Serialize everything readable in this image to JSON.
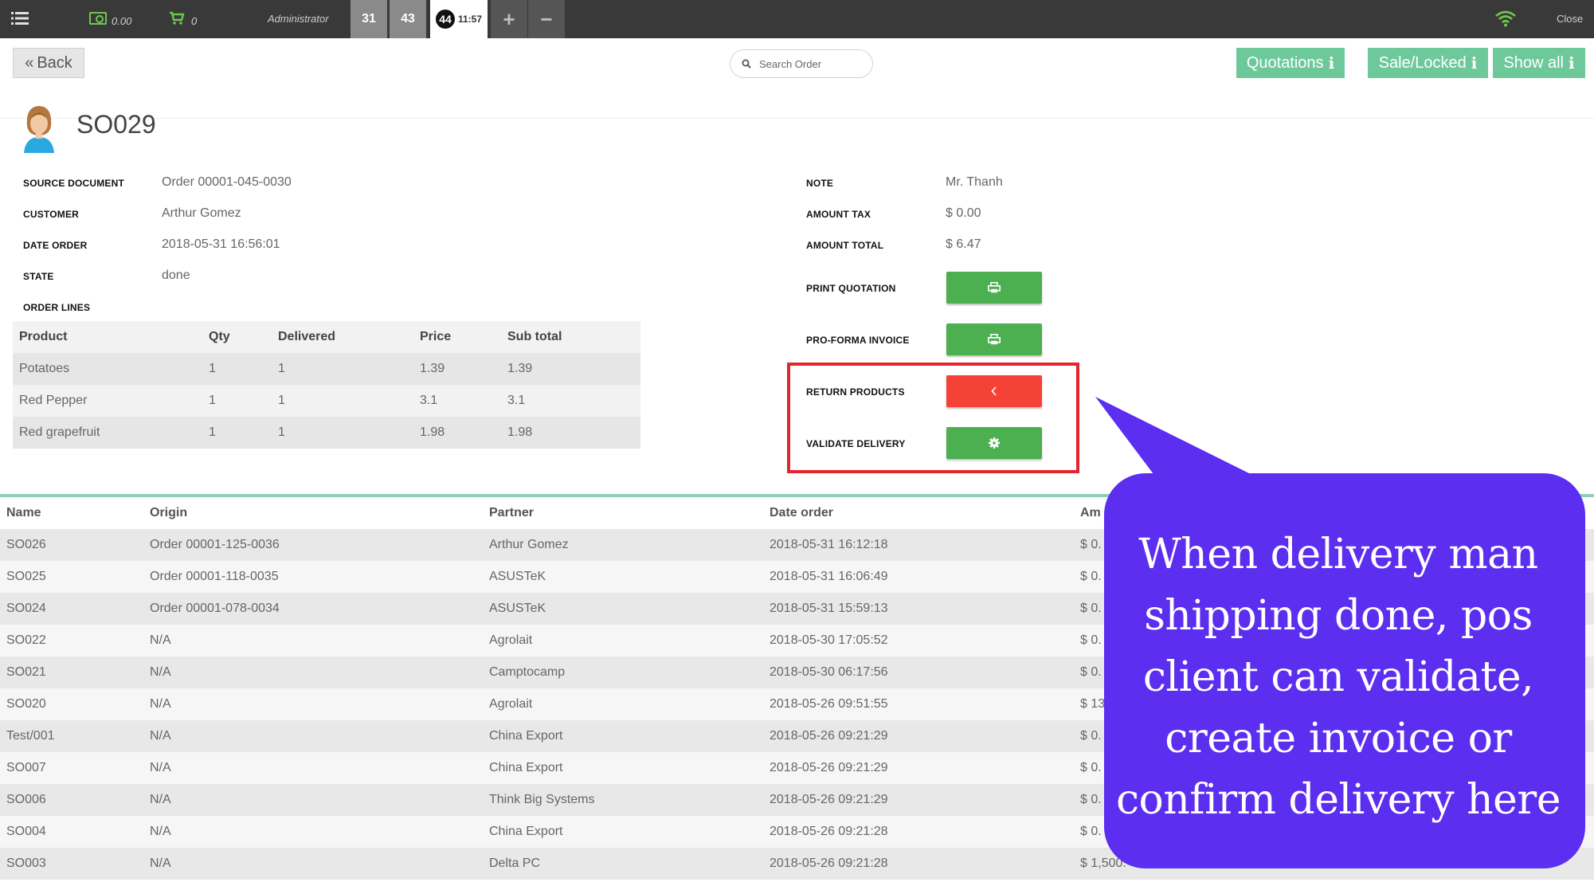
{
  "topbar": {
    "cash_amount": "0.00",
    "cart_count": "0",
    "user": "Administrator",
    "order_tabs": [
      "31",
      "43"
    ],
    "active_tab": {
      "number": "44",
      "time": "11:57"
    },
    "plus": "+",
    "minus": "−",
    "close_label": "Close"
  },
  "actions": {
    "back_label": "Back",
    "search_placeholder": "Search Order",
    "quotations_label": "Quotations",
    "sale_locked_label": "Sale/Locked",
    "show_all_label": "Show all"
  },
  "order": {
    "name": "SO029",
    "fields_left": [
      {
        "label": "SOURCE DOCUMENT",
        "value": "Order 00001-045-0030"
      },
      {
        "label": "CUSTOMER",
        "value": "Arthur Gomez"
      },
      {
        "label": "DATE ORDER",
        "value": "2018-05-31 16:56:01"
      },
      {
        "label": "STATE",
        "value": "done"
      }
    ],
    "order_lines_label": "ORDER LINES",
    "fields_right": [
      {
        "label": "NOTE",
        "value": "Mr. Thanh"
      },
      {
        "label": "AMOUNT TAX",
        "value": "$ 0.00"
      },
      {
        "label": "AMOUNT TOTAL",
        "value": "$ 6.47"
      }
    ],
    "buttons": [
      {
        "label": "PRINT QUOTATION",
        "icon": "print-icon",
        "color": "#4caf50"
      },
      {
        "label": "PRO-FORMA INVOICE",
        "icon": "print-icon",
        "color": "#4caf50"
      },
      {
        "label": "RETURN PRODUCTS",
        "icon": "chevron-left-icon",
        "color": "#f44336"
      },
      {
        "label": "VALIDATE DELIVERY",
        "icon": "gear-icon",
        "color": "#4caf50"
      }
    ],
    "lines": {
      "headers": [
        "Product",
        "Qty",
        "Delivered",
        "Price",
        "Sub total"
      ],
      "rows": [
        [
          "Potatoes",
          "1",
          "1",
          "1.39",
          "1.39"
        ],
        [
          "Red Pepper",
          "1",
          "1",
          "3.1",
          "3.1"
        ],
        [
          "Red grapefruit",
          "1",
          "1",
          "1.98",
          "1.98"
        ]
      ]
    }
  },
  "list": {
    "headers": [
      "Name",
      "Origin",
      "Partner",
      "Date order",
      "Am"
    ],
    "rows": [
      [
        "SO026",
        "Order 00001-125-0036",
        "Arthur Gomez",
        "2018-05-31 16:12:18",
        "$ 0."
      ],
      [
        "SO025",
        "Order 00001-118-0035",
        "ASUSTeK",
        "2018-05-31 16:06:49",
        "$ 0."
      ],
      [
        "SO024",
        "Order 00001-078-0034",
        "ASUSTeK",
        "2018-05-31 15:59:13",
        "$ 0."
      ],
      [
        "SO022",
        "N/A",
        "Agrolait",
        "2018-05-30 17:05:52",
        "$ 0."
      ],
      [
        "SO021",
        "N/A",
        "Camptocamp",
        "2018-05-30 06:17:56",
        "$ 0."
      ],
      [
        "SO020",
        "N/A",
        "Agrolait",
        "2018-05-26 09:51:55",
        "$ 13"
      ],
      [
        "Test/001",
        "N/A",
        "China Export",
        "2018-05-26 09:21:29",
        "$ 0."
      ],
      [
        "SO007",
        "N/A",
        "China Export",
        "2018-05-26 09:21:29",
        "$ 0."
      ],
      [
        "SO006",
        "N/A",
        "Think Big Systems",
        "2018-05-26 09:21:29",
        "$ 0."
      ],
      [
        "SO004",
        "N/A",
        "China Export",
        "2018-05-26 09:21:28",
        "$ 0."
      ],
      [
        "SO003",
        "N/A",
        "Delta PC",
        "2018-05-26 09:21:28",
        "$ 1,500."
      ]
    ]
  },
  "callout": {
    "lines": [
      "When delivery man",
      "shipping done, pos",
      "client can validate,",
      "create invoice or",
      "confirm delivery here"
    ],
    "color": "#5b2ef0"
  },
  "colors": {
    "accent_green": "#6ec99a",
    "button_green": "#4caf50",
    "button_red": "#f44336",
    "highlight_frame": "#e3262e"
  }
}
